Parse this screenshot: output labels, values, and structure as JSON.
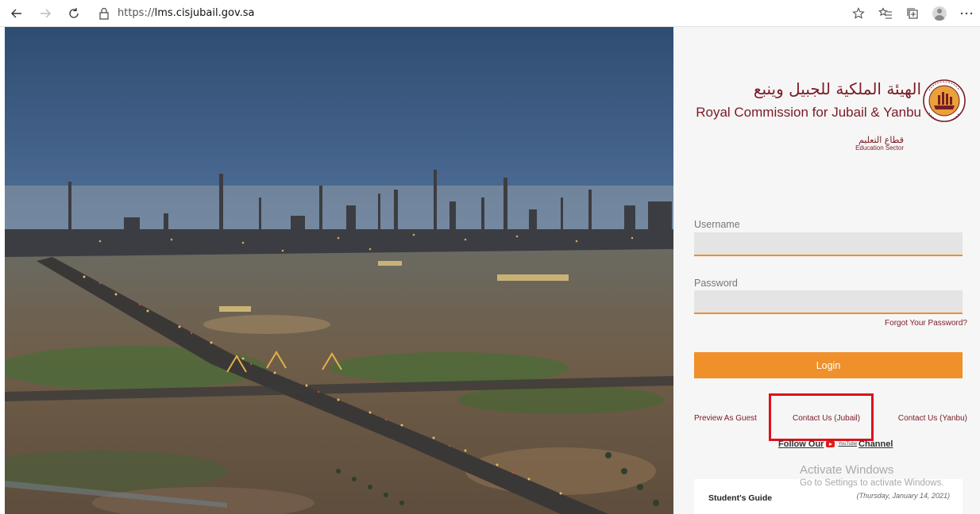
{
  "browser": {
    "url_prefix": "https://",
    "url_domain": "lms.cisjubail.gov.sa",
    "icons": [
      "back-icon",
      "forward-icon",
      "reload-icon",
      "lock-icon",
      "favorite-star-icon",
      "favorites-list-icon",
      "collections-icon",
      "profile-icon",
      "more-icon"
    ]
  },
  "logo": {
    "arabic_name": "الهيئة الملكية للجبيل وينبع",
    "english_name": "Royal Commission for Jubail & Yanbu",
    "sector_arabic": "قطاع التعليم",
    "sector_english": "Education Sector"
  },
  "form": {
    "username_label": "Username",
    "username_value": "",
    "password_label": "Password",
    "password_value": "",
    "forgot_link": "Forgot Your Password?",
    "login_label": "Login"
  },
  "links": {
    "preview_guest": "Preview As Guest",
    "contact_jubail": "Contact Us (Jubail)",
    "contact_yanbu": "Contact Us (Yanbu)"
  },
  "follow": {
    "prefix": "Follow Our",
    "youtube_word": "YouTube",
    "suffix": "Channel"
  },
  "guide": {
    "title": "Student's Guide",
    "date": "(Thursday, January 14, 2021)"
  },
  "watermark": {
    "title": "Activate Windows",
    "subtitle": "Go to Settings to activate Windows."
  },
  "colors": {
    "accent_orange": "#f0902a",
    "brand_maroon": "#7a1b24",
    "highlight_red": "#e0101a"
  }
}
